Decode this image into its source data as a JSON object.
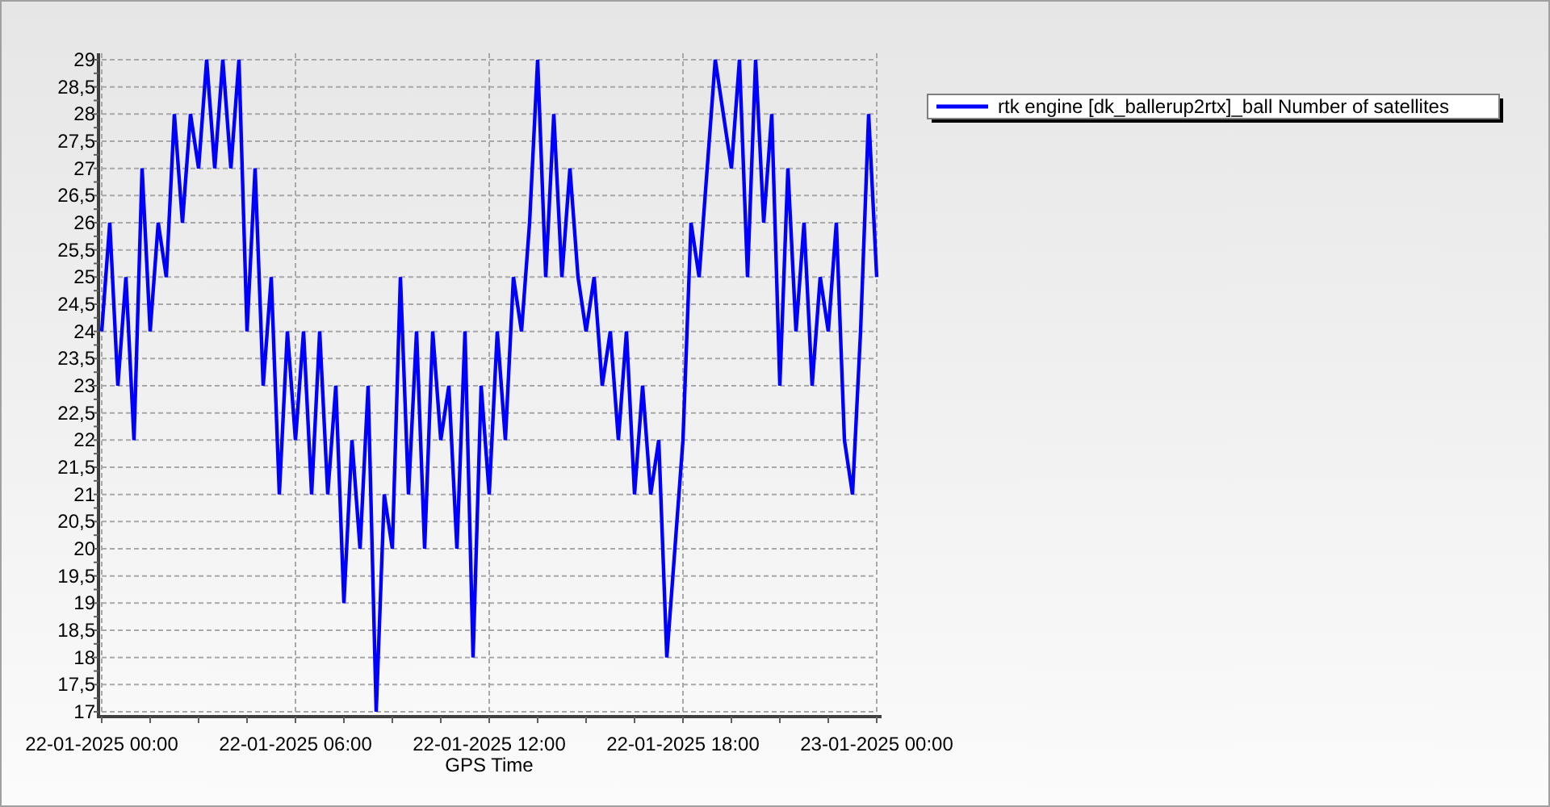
{
  "chart_data": {
    "type": "line",
    "grid": true,
    "xlabel": "GPS Time",
    "ylim": [
      17,
      29
    ],
    "yticks": [
      {
        "value": 17,
        "label": "17"
      },
      {
        "value": 17.5,
        "label": "17,5"
      },
      {
        "value": 18,
        "label": "18"
      },
      {
        "value": 18.5,
        "label": "18,5"
      },
      {
        "value": 19,
        "label": "19"
      },
      {
        "value": 19.5,
        "label": "19,5"
      },
      {
        "value": 20,
        "label": "20"
      },
      {
        "value": 20.5,
        "label": "20,5"
      },
      {
        "value": 21,
        "label": "21"
      },
      {
        "value": 21.5,
        "label": "21,5"
      },
      {
        "value": 22,
        "label": "22"
      },
      {
        "value": 22.5,
        "label": "22,5"
      },
      {
        "value": 23,
        "label": "23"
      },
      {
        "value": 23.5,
        "label": "23,5"
      },
      {
        "value": 24,
        "label": "24"
      },
      {
        "value": 24.5,
        "label": "24,5"
      },
      {
        "value": 25,
        "label": "25"
      },
      {
        "value": 25.5,
        "label": "25,5"
      },
      {
        "value": 26,
        "label": "26"
      },
      {
        "value": 26.5,
        "label": "26,5"
      },
      {
        "value": 27,
        "label": "27"
      },
      {
        "value": 27.5,
        "label": "27,5"
      },
      {
        "value": 28,
        "label": "28"
      },
      {
        "value": 28.5,
        "label": "28,5"
      },
      {
        "value": 29,
        "label": "29"
      }
    ],
    "categories": [
      "22-01-2025 00:00",
      null,
      null,
      null,
      null,
      null,
      null,
      null,
      null,
      null,
      null,
      null,
      null,
      null,
      null,
      null,
      null,
      null,
      null,
      null,
      null,
      null,
      null,
      null,
      "22-01-2025 06:00",
      null,
      null,
      null,
      null,
      null,
      null,
      null,
      null,
      null,
      null,
      null,
      null,
      null,
      null,
      null,
      null,
      null,
      null,
      null,
      null,
      null,
      null,
      null,
      "22-01-2025 12:00",
      null,
      null,
      null,
      null,
      null,
      null,
      null,
      null,
      null,
      null,
      null,
      null,
      null,
      null,
      null,
      null,
      null,
      null,
      null,
      null,
      null,
      null,
      null,
      "22-01-2025 18:00",
      null,
      null,
      null,
      null,
      null,
      null,
      null,
      null,
      null,
      null,
      null,
      null,
      null,
      null,
      null,
      null,
      null,
      null,
      null,
      null,
      null,
      null,
      null,
      "23-01-2025 00:00"
    ],
    "series": [
      {
        "name": "rtk engine [dk_ballerup2rtx]_ball Number of satellites",
        "color": "#0000ff",
        "values": [
          24,
          26,
          23,
          25,
          22,
          27,
          24,
          26,
          25,
          28,
          26,
          28,
          27,
          29,
          27,
          29,
          27,
          29,
          24,
          27,
          23,
          25,
          21,
          24,
          22,
          24,
          21,
          24,
          21,
          23,
          19,
          22,
          20,
          23,
          17,
          21,
          20,
          25,
          21,
          24,
          20,
          24,
          22,
          23,
          20,
          24,
          18,
          23,
          21,
          24,
          22,
          25,
          24,
          26,
          29,
          25,
          28,
          25,
          27,
          25,
          24,
          25,
          23,
          24,
          22,
          24,
          21,
          23,
          21,
          22,
          18,
          20,
          22,
          26,
          25,
          27,
          29,
          28,
          27,
          29,
          25,
          29,
          26,
          28,
          23,
          27,
          24,
          26,
          23,
          25,
          24,
          26,
          22,
          21,
          24,
          28,
          25
        ]
      }
    ]
  }
}
